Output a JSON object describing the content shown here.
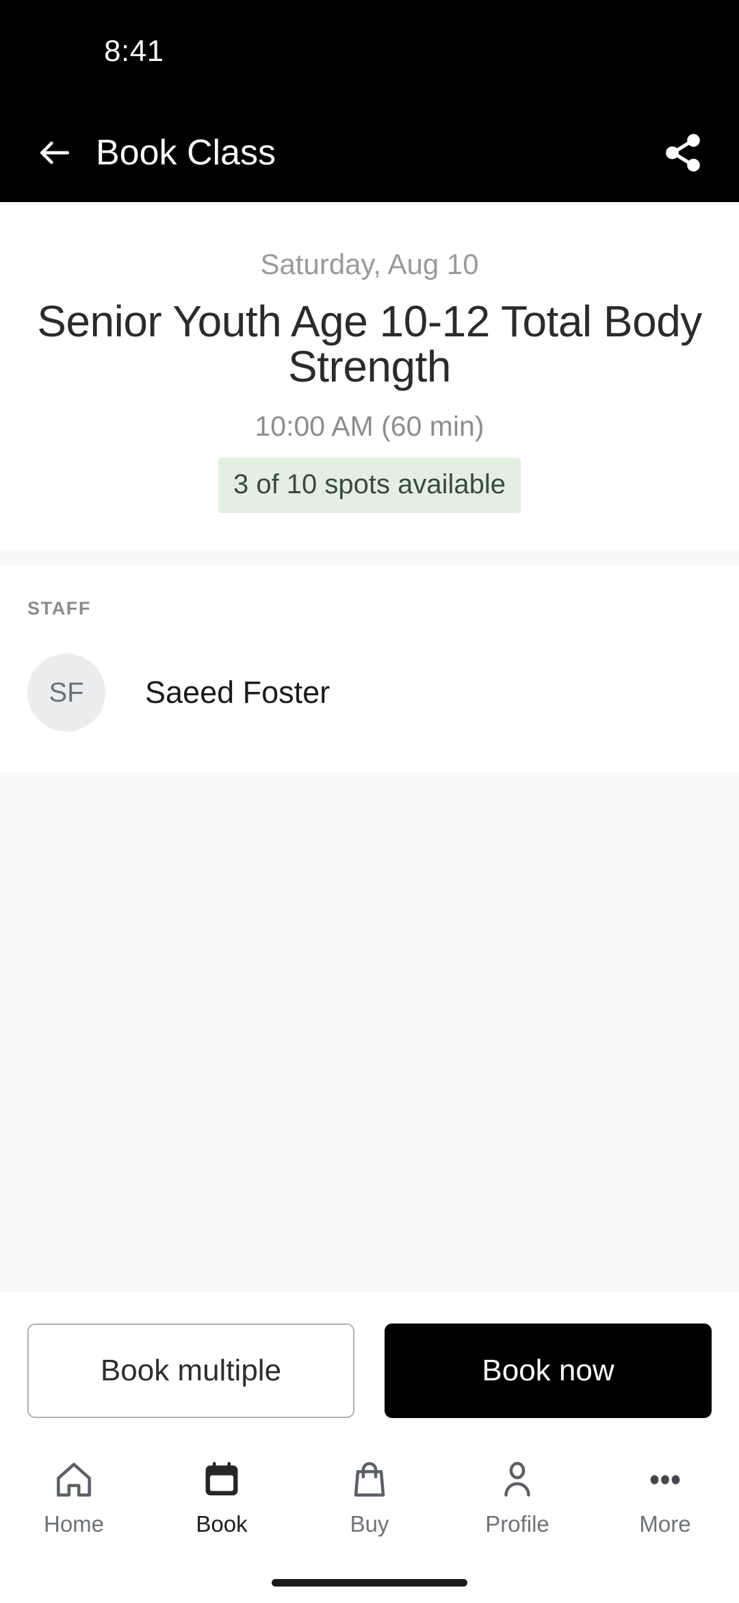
{
  "status_bar": {
    "time": "8:41"
  },
  "app_bar": {
    "title": "Book Class",
    "back_icon": "arrow-left-icon",
    "share_icon": "share-icon"
  },
  "class_header": {
    "date": "Saturday, Aug 10",
    "name": "Senior Youth Age 10-12 Total Body Strength",
    "time_duration": "10:00 AM (60 min)",
    "availability": "3 of 10 spots available",
    "availability_bg": "#e3efe1",
    "availability_text_color": "#3a4a3d"
  },
  "staff": {
    "section_label": "STAFF",
    "members": [
      {
        "initials": "SF",
        "name": "Saeed Foster"
      }
    ]
  },
  "actions": {
    "secondary_label": "Book multiple",
    "primary_label": "Book now",
    "primary_bg": "#000000",
    "primary_text_color": "#ffffff"
  },
  "bottom_nav": {
    "items": [
      {
        "label": "Home",
        "icon": "home-icon",
        "active": false
      },
      {
        "label": "Book",
        "icon": "calendar-icon",
        "active": true
      },
      {
        "label": "Buy",
        "icon": "shopping-bag-icon",
        "active": false
      },
      {
        "label": "Profile",
        "icon": "person-icon",
        "active": false
      },
      {
        "label": "More",
        "icon": "ellipsis-icon",
        "active": false
      }
    ]
  }
}
